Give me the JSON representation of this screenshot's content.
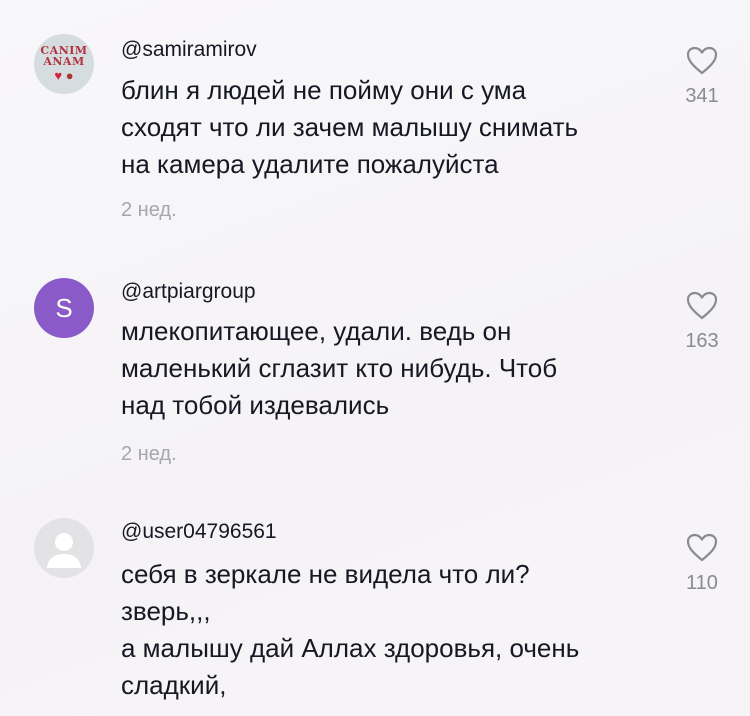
{
  "comments": [
    {
      "username": "@samiramirov",
      "avatar": {
        "type": "image",
        "text_line1": "CANIM",
        "text_line2": "ANAM",
        "icons": [
          "heart",
          "strawberry"
        ]
      },
      "text_lines": [
        "блин я людей не пойму они с ума",
        "сходят что ли зачем малышу снимать",
        "на камера удалите пожалуйста"
      ],
      "date": "2 нед.",
      "likes": "341"
    },
    {
      "username": "@artpiargroup",
      "avatar": {
        "type": "letter",
        "letter": "S",
        "color": "#8a5bc8"
      },
      "text_lines": [
        "млекопитающее, удали. ведь он",
        "маленький сглазит кто нибудь. Чтоб",
        "над тобой издевались"
      ],
      "date": "2 нед.",
      "likes": "163"
    },
    {
      "username": "@user04796561",
      "avatar": {
        "type": "default"
      },
      "text_lines": [
        "себя в зеркале не видела что ли?",
        "зверь,,,",
        "а малышу дай Аллах здоровья, очень",
        "сладкий,"
      ],
      "likes": "110"
    }
  ],
  "icons": {
    "like": "heart-outline-icon",
    "default_avatar": "person-silhouette-icon"
  },
  "colors": {
    "text": "#161823",
    "muted": "#a6a6ab",
    "like_count": "#8a8b91",
    "avatar_letter_bg": "#8a5bc8"
  }
}
